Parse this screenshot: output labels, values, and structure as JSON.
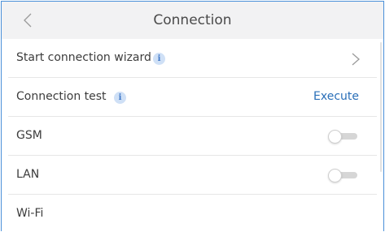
{
  "header": {
    "title": "Connection",
    "back_icon": "chevron-left-icon"
  },
  "rows": [
    {
      "label": "Start connection wizard",
      "info_glyph": "i",
      "trailing_icon": "chevron-right-icon"
    },
    {
      "label": "Connection test",
      "info_glyph": "i",
      "action_label": "Execute"
    },
    {
      "label": "GSM",
      "toggle_on": false
    },
    {
      "label": "LAN",
      "toggle_on": false
    },
    {
      "label": "Wi-Fi"
    }
  ],
  "colors": {
    "accent": "#2a6fb8",
    "header_bg": "#f2f2f3",
    "info_bg": "#cfe0f6",
    "frame_border": "#4a90d9"
  }
}
